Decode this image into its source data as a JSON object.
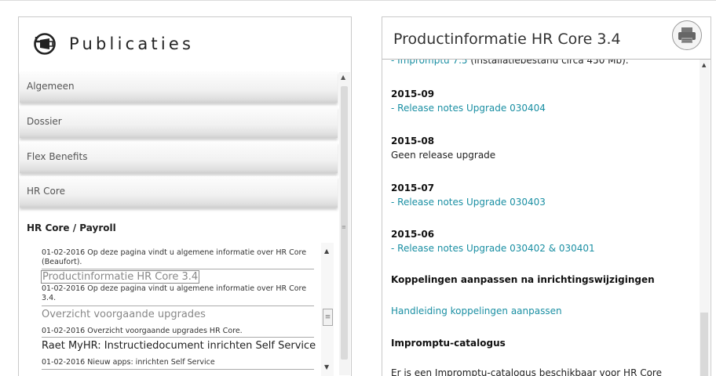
{
  "left": {
    "title": "Publicaties",
    "accordion": [
      "Algemeen",
      "Dossier",
      "Flex Benefits",
      "HR Core"
    ],
    "open_section": "HR Core / Payroll",
    "entries": [
      {
        "desc": "01-02-2016 Op deze pagina vindt u algemene informatie over HR Core (Beaufort)."
      },
      {
        "title": "Productinformatie HR Core 3.4",
        "desc": "01-02-2016 Op deze pagina vindt u algemene informatie over HR Core 3.4."
      },
      {
        "title": "Overzicht voorgaande upgrades",
        "desc": "01-02-2016 Overzicht voorgaande upgrades HR Core."
      },
      {
        "title": "Raet MyHR: Instructiedocument inrichten Self Service",
        "desc": "01-02-2016 Nieuw apps: inrichten Self Service"
      }
    ]
  },
  "right": {
    "title": "Productinformatie HR Core 3.4",
    "lines": {
      "impromptu_prefix": "- ",
      "impromptu_link": "Impromptu 7.5",
      "impromptu_suffix": " (installatiebestand circa 450 Mb).",
      "h_2015_09": "2015-09",
      "l_2015_09": "- Release notes Upgrade 030404",
      "h_2015_08": "2015-08",
      "t_2015_08": "Geen release upgrade",
      "h_2015_07": "2015-07",
      "l_2015_07": "- Release notes Upgrade 030403",
      "h_2015_06": "2015-06",
      "l_2015_06": "- Release notes Upgrade 030402 & 030401",
      "h_koppelingen": "Koppelingen aanpassen na inrichtingswijzigingen",
      "l_handleiding": "Handleiding koppelingen aanpassen",
      "h_catalogus": "Impromptu-catalogus",
      "t_catalogus": "Er is een Impromptu-catalogus beschikbaar voor HR Core"
    }
  },
  "colors": {
    "link": "#1a8fa3",
    "border": "#c9c9c9"
  }
}
